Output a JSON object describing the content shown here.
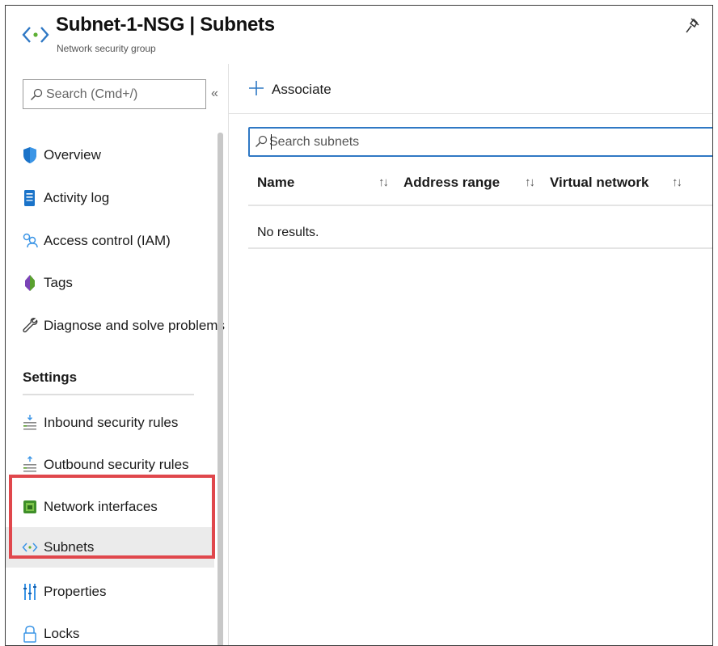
{
  "header": {
    "title": "Subnet-1-NSG | Subnets",
    "subtitle": "Network security group",
    "icon": "subnet-icon",
    "pin_icon": "pin-icon"
  },
  "sidebar": {
    "search_placeholder": "Search (Cmd+/)",
    "collapse_glyph": "«",
    "items": [
      {
        "label": "Overview",
        "icon": "shield-icon"
      },
      {
        "label": "Activity log",
        "icon": "activity-log-icon"
      },
      {
        "label": "Access control (IAM)",
        "icon": "people-icon"
      },
      {
        "label": "Tags",
        "icon": "tag-icon"
      },
      {
        "label": "Diagnose and solve problems",
        "icon": "wrench-icon"
      }
    ],
    "settings_header": "Settings",
    "settings_items": [
      {
        "label": "Inbound security rules",
        "icon": "inbound-rules-icon"
      },
      {
        "label": "Outbound security rules",
        "icon": "outbound-rules-icon"
      },
      {
        "label": "Network interfaces",
        "icon": "network-interface-icon"
      },
      {
        "label": "Subnets",
        "icon": "subnet-icon",
        "selected": true
      },
      {
        "label": "Properties",
        "icon": "properties-icon"
      },
      {
        "label": "Locks",
        "icon": "lock-icon"
      }
    ],
    "highlight_color": "#e0474c"
  },
  "main": {
    "toolbar": {
      "associate_label": "Associate"
    },
    "search_placeholder": "Search subnets",
    "columns": [
      "Name",
      "Address range",
      "Virtual network"
    ],
    "sort_glyph": "↑↓",
    "empty_text": "No results."
  },
  "colors": {
    "accent": "#2f78c4",
    "highlight": "#e0474c",
    "selected_bg": "#ebebeb"
  }
}
